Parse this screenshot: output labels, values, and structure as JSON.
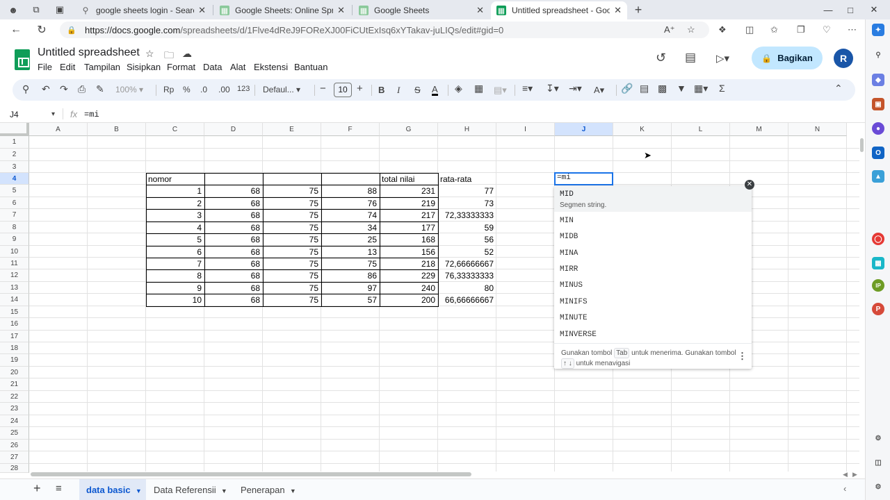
{
  "browser": {
    "tabs": [
      {
        "title": "google sheets login - Search",
        "icon": "search-icon"
      },
      {
        "title": "Google Sheets: Online Spreadsh",
        "icon": "sheets-icon"
      },
      {
        "title": "Google Sheets",
        "icon": "sheets-icon"
      },
      {
        "title": "Untitled spreadsheet - Google Sp",
        "icon": "sheets-icon",
        "active": true
      }
    ],
    "url_domain": "https://docs.google.com",
    "url_path": "/spreadsheets/d/1Flve4dReJ9FOReXJ00FiCUtExIsq6xYTakav-juLIQs/edit#gid=0"
  },
  "doc": {
    "title": "Untitled spreadsheet",
    "menu": [
      "File",
      "Edit",
      "Tampilan",
      "Sisipkan",
      "Format",
      "Data",
      "Alat",
      "Ekstensi",
      "Bantuan"
    ],
    "share_label": "Bagikan",
    "avatar_letter": "R"
  },
  "toolbar": {
    "zoom": "100%",
    "currency": "Rp",
    "percent": "%",
    "dec_less": ".0",
    "dec_more": ".00",
    "number_format": "123",
    "font": "Defaul...",
    "font_size": "10"
  },
  "formula_bar": {
    "name_box": "J4",
    "fx": "fx",
    "value": "=mi"
  },
  "grid": {
    "columns": [
      "A",
      "B",
      "C",
      "D",
      "E",
      "F",
      "G",
      "H",
      "I",
      "J",
      "K",
      "L",
      "M",
      "N"
    ],
    "rows": [
      "1",
      "2",
      "3",
      "4",
      "5",
      "6",
      "7",
      "8",
      "9",
      "10",
      "11",
      "12",
      "13",
      "14",
      "15",
      "16",
      "17",
      "18",
      "19",
      "20",
      "21",
      "22",
      "23",
      "24",
      "25",
      "26",
      "27",
      "28"
    ],
    "header_row": {
      "nomor": "nomor",
      "total": "total nilai",
      "rata": "rata-rata"
    },
    "table": [
      [
        "1",
        "68",
        "75",
        "88",
        "231",
        "77"
      ],
      [
        "2",
        "68",
        "75",
        "76",
        "219",
        "73"
      ],
      [
        "3",
        "68",
        "75",
        "74",
        "217",
        "72,33333333"
      ],
      [
        "4",
        "68",
        "75",
        "34",
        "177",
        "59"
      ],
      [
        "5",
        "68",
        "75",
        "25",
        "168",
        "56"
      ],
      [
        "6",
        "68",
        "75",
        "13",
        "156",
        "52"
      ],
      [
        "7",
        "68",
        "75",
        "75",
        "218",
        "72,66666667"
      ],
      [
        "8",
        "68",
        "75",
        "86",
        "229",
        "76,33333333"
      ],
      [
        "9",
        "68",
        "75",
        "97",
        "240",
        "80"
      ],
      [
        "10",
        "68",
        "75",
        "57",
        "200",
        "66,66666667"
      ]
    ],
    "active_cell_value": "=mi"
  },
  "autocomplete": {
    "items": [
      "MID",
      "MIN",
      "MIDB",
      "MINA",
      "MIRR",
      "MINUS",
      "MINIFS",
      "MINUTE",
      "MINVERSE"
    ],
    "description": "Segmen string.",
    "footer_a": "Gunakan tombol",
    "footer_key": "Tab",
    "footer_b": "untuk menerima. Gunakan tombol",
    "footer_arrows": "↑ ↓",
    "footer_c": "untuk menavigasi"
  },
  "sheets": [
    "data basic",
    "Data Referensii",
    "Penerapan"
  ],
  "colors": {
    "accent": "#0b57d0",
    "share_bg": "#c2e7ff",
    "sheets_green": "#0f9d58",
    "toolbar_bg": "#edf2fa"
  }
}
